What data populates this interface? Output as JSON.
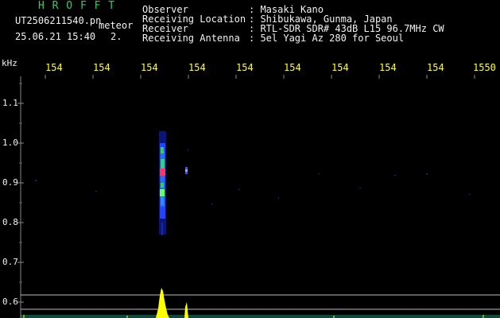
{
  "app": {
    "title": "H R O F F T",
    "file": "UT2506211540.pn",
    "mode": "meteor",
    "datetime": "25.06.21 15:40",
    "count": "2."
  },
  "info": {
    "observer_label": "Observer",
    "observer_value": ": Masaki Kano",
    "location_label": "Receiving Location",
    "location_value": ": Shibukawa, Gunma, Japan",
    "receiver_label": "Receiver",
    "receiver_value": ": RTL-SDR SDR# 43dB L15 96.7MHz CW",
    "antenna_label": "Receiving Antenna",
    "antenna_value": ": 5el Yagi Az 280 for Seoul"
  },
  "axis": {
    "y_unit": "kHz",
    "x_ticks": [
      "154",
      "154",
      "154",
      "154",
      "154",
      "154",
      "154",
      "154",
      "154",
      "1550"
    ],
    "y_ticks": [
      "1.1",
      "1.0",
      "0.9",
      "0.8",
      "0.7",
      "0.6"
    ]
  },
  "colors": {
    "header_title": "#33cc66",
    "axis_label": "#ffff33",
    "text": "#f2f2f2",
    "echo_core": "#ff3366",
    "echo_mid": "#33cc66",
    "echo_outer": "#3355ff",
    "spectrum": "#ffff00"
  }
}
